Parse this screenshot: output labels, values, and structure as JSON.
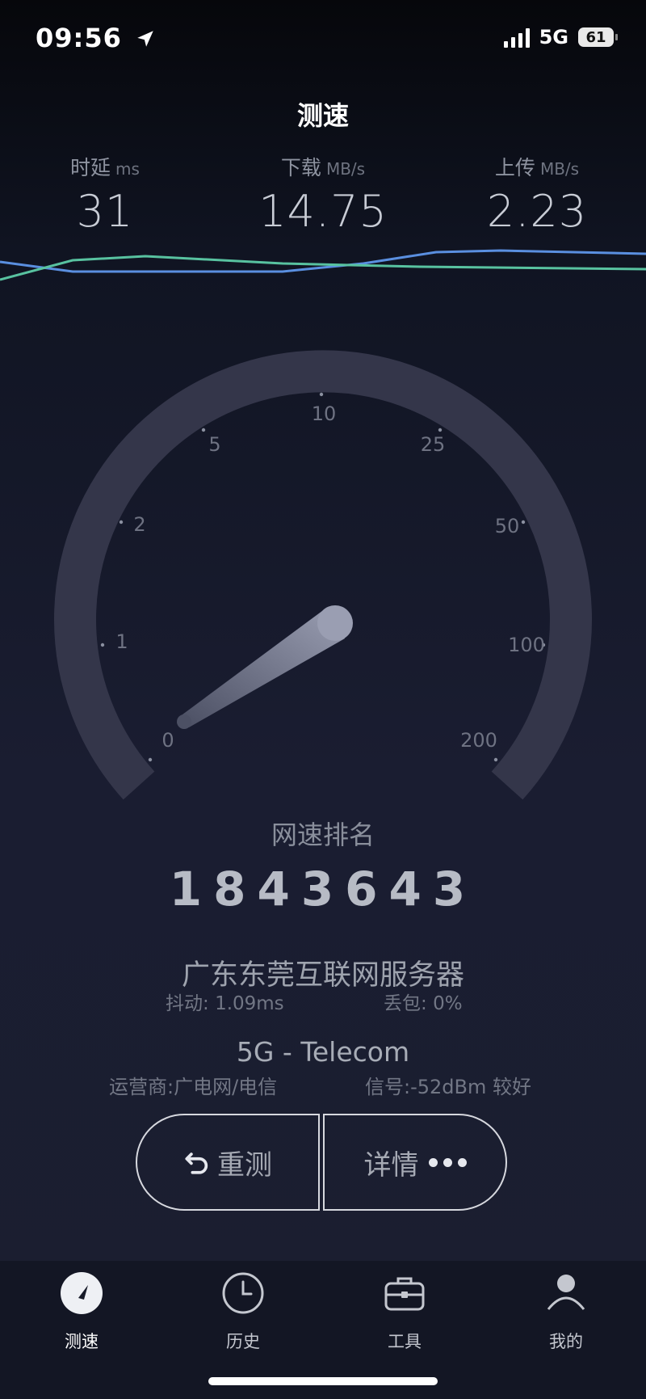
{
  "status_bar": {
    "time": "09:56",
    "network": "5G",
    "battery": "61"
  },
  "page_title": "测速",
  "metrics": [
    {
      "label": "时延",
      "unit": "ms",
      "value": "31"
    },
    {
      "label": "下载",
      "unit": "MB/s",
      "value": "14.75"
    },
    {
      "label": "上传",
      "unit": "MB/s",
      "value": "2.23"
    }
  ],
  "colors": {
    "download_line": "#5a8fe0",
    "upload_line": "#58c2a0",
    "gauge_track": "#34364a",
    "needle": "#7d8197"
  },
  "gauge": {
    "ticks": [
      "0",
      "1",
      "2",
      "5",
      "10",
      "25",
      "50",
      "100",
      "200"
    ]
  },
  "rank": {
    "title": "网速排名",
    "value": "1843643"
  },
  "server": {
    "name": "广东东莞互联网服务器",
    "jitter_label": "抖动: ",
    "jitter_value": "1.09ms",
    "loss_label": "丢包: ",
    "loss_value": "0%"
  },
  "network": {
    "name": "5G - Telecom",
    "operator": "运营商:广电网/电信",
    "signal": "信号:-52dBm 较好"
  },
  "buttons": {
    "retest": "重测",
    "detail": "详情"
  },
  "tabs": [
    {
      "label": "测速",
      "icon": "speedometer-icon"
    },
    {
      "label": "历史",
      "icon": "clock-icon"
    },
    {
      "label": "工具",
      "icon": "toolbox-icon"
    },
    {
      "label": "我的",
      "icon": "person-icon"
    }
  ]
}
